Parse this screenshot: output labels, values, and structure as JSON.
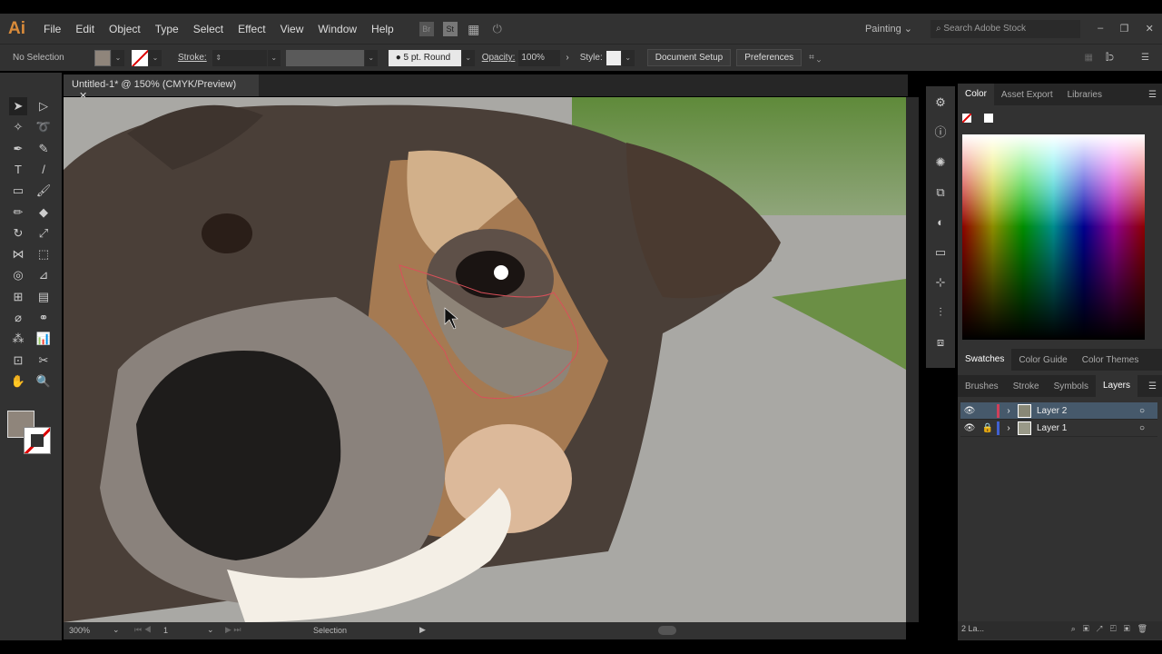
{
  "app": {
    "logo": "Ai",
    "menus": [
      "File",
      "Edit",
      "Object",
      "Type",
      "Select",
      "Effect",
      "View",
      "Window",
      "Help"
    ],
    "bridge": "Br",
    "stock": "St",
    "workspace": "Painting",
    "search_placeholder": "Search Adobe Stock"
  },
  "control": {
    "selection": "No Selection",
    "stroke_label": "Stroke:",
    "brush": "5 pt. Round",
    "opacity_label": "Opacity:",
    "opacity": "100%",
    "style_label": "Style:",
    "document_setup": "Document Setup",
    "preferences": "Preferences",
    "fill_color": "#8f857b"
  },
  "document": {
    "tab_title": "Untitled-1* @ 150% (CMYK/Preview)"
  },
  "status": {
    "zoom": "300%",
    "artboard": "1",
    "mode": "Selection",
    "layer_count": "2 La..."
  },
  "panels": {
    "top_tabs": [
      "Color",
      "Asset Export",
      "Libraries"
    ],
    "mid_tabs": [
      "Swatches",
      "Color Guide",
      "Color Themes"
    ],
    "bottom_tabs": [
      "Brushes",
      "Stroke",
      "Symbols",
      "Layers"
    ],
    "layers": [
      {
        "name": "Layer 2",
        "color": "#d0405a",
        "locked": false,
        "selected": true
      },
      {
        "name": "Layer 1",
        "color": "#4060d0",
        "locked": true,
        "selected": false
      }
    ]
  }
}
